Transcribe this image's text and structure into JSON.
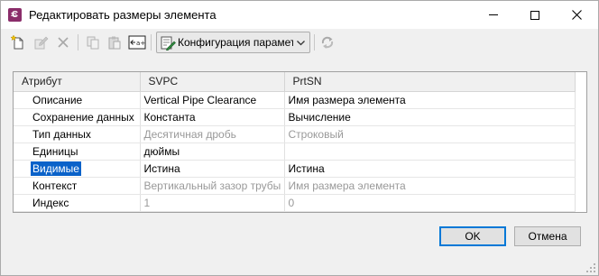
{
  "window": {
    "title": "Редактировать размеры элемента",
    "app_icon_letter": "C",
    "app_icon_sub": "3D",
    "icon_color": "#8a2d6a"
  },
  "toolbar": {
    "configuration_label": "Конфигурация параметров"
  },
  "grid": {
    "columns": [
      "Атрибут",
      "SVPC",
      "PrtSN"
    ],
    "rows": [
      {
        "attribute": "Описание",
        "svpc": "Vertical Pipe Clearance",
        "prtsn": "Имя размера элемента"
      },
      {
        "attribute": "Сохранение данных",
        "svpc": "Константа",
        "prtsn": "Вычисление"
      },
      {
        "attribute": "Тип данных",
        "svpc": "Десятичная дробь",
        "prtsn": "Строковый"
      },
      {
        "attribute": "Единицы",
        "svpc": "дюймы",
        "prtsn": ""
      },
      {
        "attribute": "Видимые",
        "svpc": "Истина",
        "prtsn": "Истина"
      },
      {
        "attribute": "Контекст",
        "svpc": "Вертикальный зазор трубы",
        "prtsn": "Имя размера элемента"
      },
      {
        "attribute": "Индекс",
        "svpc": "1",
        "prtsn": "0"
      }
    ],
    "selection_color": "#0a62c9"
  },
  "buttons": {
    "ok": "OK",
    "cancel": "Отмена"
  }
}
